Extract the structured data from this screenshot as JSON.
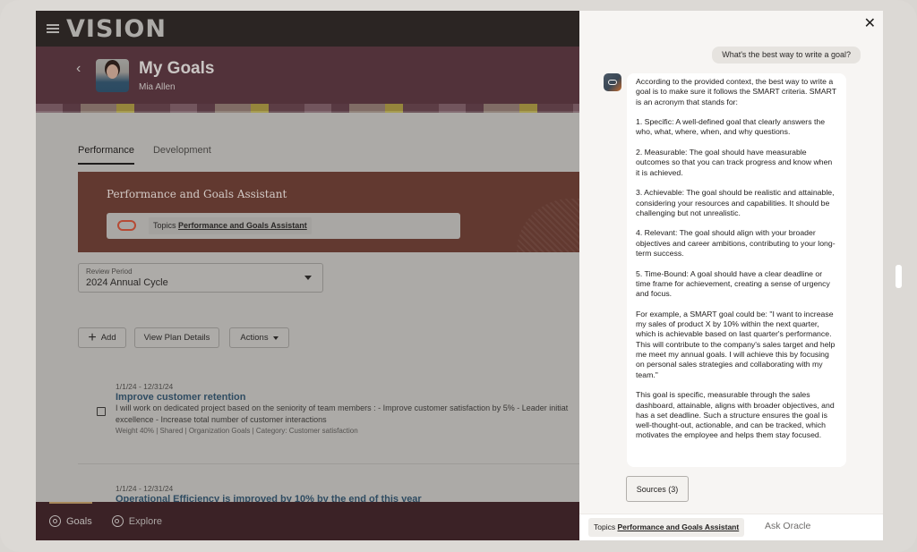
{
  "app": {
    "logo": "VISION",
    "page_title": "My Goals",
    "user_name": "Mia Allen",
    "tabs": [
      {
        "label": "Performance",
        "active": true
      },
      {
        "label": "Development",
        "active": false
      }
    ],
    "assistant_banner": {
      "title": "Performance and Goals Assistant",
      "topic_prefix": "Topics",
      "topic_name": "Performance and Goals Assistant"
    },
    "review_period": {
      "label": "Review Period",
      "value": "2024 Annual Cycle"
    },
    "toolbar": {
      "add_label": "Add",
      "view_plan_label": "View Plan Details",
      "actions_label": "Actions"
    },
    "goals": [
      {
        "date_range": "1/1/24 - 12/31/24",
        "title": "Improve customer retention",
        "description_line1": "I will work on dedicated project based on the seniority of team members : - Improve customer satisfaction by 5% - Leader initiat",
        "description_line2": "excellence - Increase total number of customer interactions",
        "meta": "Weight 40% | Shared | Organization Goals | Category: Customer satisfaction"
      },
      {
        "date_range": "1/1/24 - 12/31/24",
        "title": "Operational Efficiency is improved by 10% by the end of this year"
      }
    ],
    "bottom_nav": [
      {
        "label": "Goals",
        "icon": "target-icon",
        "active": true
      },
      {
        "label": "Explore",
        "icon": "explore-icon",
        "active": false
      }
    ]
  },
  "chat": {
    "close_icon": "close-icon",
    "user_message": "What's the best way to write a goal?",
    "bot_paragraphs": [
      "According to the provided context, the best way to write a goal is to make sure it follows the SMART criteria. SMART is an acronym that stands for:",
      "1. Specific: A well-defined goal that clearly answers the who, what, where, when, and why questions.",
      "2. Measurable: The goal should have measurable outcomes so that you can track progress and know when it is achieved.",
      "3. Achievable: The goal should be realistic and attainable, considering your resources and capabilities. It should be challenging but not unrealistic.",
      "4. Relevant: The goal should align with your broader objectives and career ambitions, contributing to your long-term success.",
      "5. Time-Bound: A goal should have a clear deadline or time frame for achievement, creating a sense of urgency and focus.",
      "For example, a SMART goal could be: \"I want to increase my sales of product X by 10% within the next quarter, which is achievable based on last quarter's performance. This will contribute to the company's sales target and help me meet my annual goals. I will achieve this by focusing on personal sales strategies and collaborating with my team.\"",
      "This goal is specific, measurable through the sales dashboard, attainable, aligns with broader objectives, and has a set deadline. Such a structure ensures the goal is well-thought-out, actionable, and can be tracked, which motivates the employee and helps them stay focused."
    ],
    "sources_label": "Sources (3)",
    "input": {
      "topic_prefix": "Topics",
      "topic_name": "Performance and Goals Assistant",
      "placeholder": "Ask Oracle"
    }
  }
}
